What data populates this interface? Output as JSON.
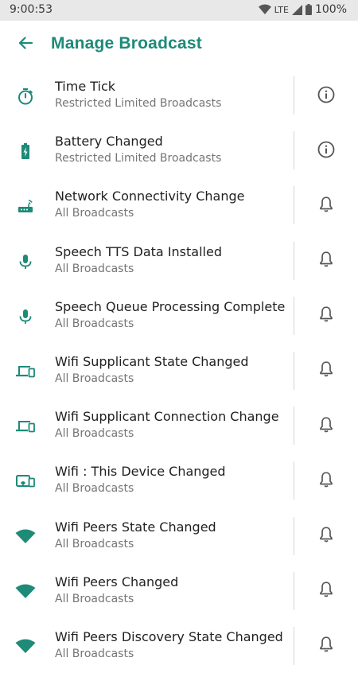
{
  "status_bar": {
    "time": "9:00:53",
    "network": "LTE",
    "battery": "100%"
  },
  "header": {
    "title": "Manage Broadcast",
    "accent_color": "#1e8a78"
  },
  "broadcasts": [
    {
      "title": "Time Tick",
      "subtitle": "Restricted Limited Broadcasts",
      "icon": "timer-icon",
      "action": "info-icon"
    },
    {
      "title": "Battery Changed",
      "subtitle": "Restricted Limited Broadcasts",
      "icon": "battery-charging-icon",
      "action": "info-icon"
    },
    {
      "title": "Network Connectivity Change",
      "subtitle": "All Broadcasts",
      "icon": "router-icon",
      "action": "bell-icon"
    },
    {
      "title": "Speech TTS Data Installed",
      "subtitle": "All Broadcasts",
      "icon": "microphone-icon",
      "action": "bell-icon"
    },
    {
      "title": "Speech Queue Processing Complete",
      "subtitle": "All Broadcasts",
      "icon": "microphone-icon",
      "action": "bell-icon"
    },
    {
      "title": "Wifi Supplicant State Changed",
      "subtitle": "All Broadcasts",
      "icon": "devices-icon",
      "action": "bell-icon"
    },
    {
      "title": "Wifi Supplicant Connection Change",
      "subtitle": "All Broadcasts",
      "icon": "devices-icon",
      "action": "bell-icon"
    },
    {
      "title": "Wifi : This Device Changed",
      "subtitle": "All Broadcasts",
      "icon": "device-wifi-icon",
      "action": "bell-icon"
    },
    {
      "title": "Wifi Peers State Changed",
      "subtitle": "All Broadcasts",
      "icon": "wifi-icon",
      "action": "bell-icon"
    },
    {
      "title": "Wifi Peers Changed",
      "subtitle": "All Broadcasts",
      "icon": "wifi-icon",
      "action": "bell-icon"
    },
    {
      "title": "Wifi Peers Discovery State Changed",
      "subtitle": "All Broadcasts",
      "icon": "wifi-icon",
      "action": "bell-icon"
    }
  ]
}
